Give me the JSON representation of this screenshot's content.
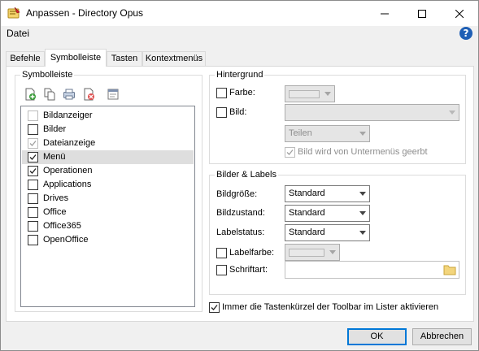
{
  "window": {
    "title": "Anpassen - Directory Opus"
  },
  "menubar": {
    "file_label": "Datei"
  },
  "help": {
    "icon": "help-icon",
    "glyph": "?"
  },
  "tabs": [
    {
      "label": "Befehle",
      "active": false
    },
    {
      "label": "Symbolleiste",
      "active": true
    },
    {
      "label": "Tasten",
      "active": false
    },
    {
      "label": "Kontextmenüs",
      "active": false
    }
  ],
  "toolbar_group": {
    "label": "Symbolleiste",
    "icons": [
      "new-toolbar-icon",
      "copy-toolbar-icon",
      "save-toolbar-icon",
      "delete-toolbar-icon",
      "properties-toolbar-icon"
    ],
    "items": [
      {
        "label": "Bildanzeiger",
        "checked": false,
        "disabled": true,
        "selected": false
      },
      {
        "label": "Bilder",
        "checked": false,
        "disabled": false,
        "selected": false
      },
      {
        "label": "Dateianzeige",
        "checked": true,
        "disabled": true,
        "selected": false
      },
      {
        "label": "Menü",
        "checked": true,
        "disabled": false,
        "selected": true
      },
      {
        "label": "Operationen",
        "checked": true,
        "disabled": false,
        "selected": false
      },
      {
        "label": "Applications",
        "checked": false,
        "disabled": false,
        "selected": false
      },
      {
        "label": "Drives",
        "checked": false,
        "disabled": false,
        "selected": false
      },
      {
        "label": "Office",
        "checked": false,
        "disabled": false,
        "selected": false
      },
      {
        "label": "Office365",
        "checked": false,
        "disabled": false,
        "selected": false
      },
      {
        "label": "OpenOffice",
        "checked": false,
        "disabled": false,
        "selected": false
      }
    ]
  },
  "background_group": {
    "label": "Hintergrund",
    "color_label": "Farbe:",
    "image_label": "Bild:",
    "image_value": "",
    "tile_value": "Teilen",
    "inherit_label": "Bild wird von Untermenüs geerbt",
    "inherit_checked": true
  },
  "images_group": {
    "label": "Bilder & Labels",
    "image_size_label": "Bildgröße:",
    "image_size_value": "Standard",
    "image_state_label": "Bildzustand:",
    "image_state_value": "Standard",
    "label_status_label": "Labelstatus:",
    "label_status_value": "Standard",
    "label_color_label": "Labelfarbe:",
    "font_label": "Schriftart:",
    "font_value": ""
  },
  "footer": {
    "shortcut_label": "Immer die Tastenkürzel der Toolbar im Lister aktivieren",
    "shortcut_checked": true,
    "ok_label": "OK",
    "cancel_label": "Abbrechen"
  },
  "colors": {
    "accent": "#0078d7",
    "help_blue": "#1f5fb5",
    "selection": "#dedede"
  }
}
